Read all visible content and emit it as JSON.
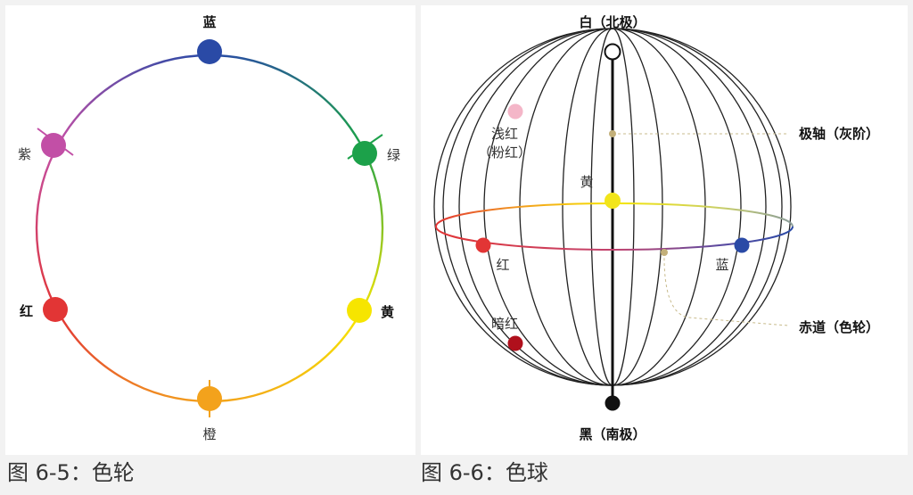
{
  "color_wheel": {
    "caption": "图 6-5：色轮",
    "labels": {
      "blue": "蓝",
      "green": "绿",
      "yellow": "黄",
      "orange": "橙",
      "red": "红",
      "purple": "紫"
    },
    "colors": {
      "blue": "#2a4aa6",
      "green": "#1ca14a",
      "yellow": "#f6e500",
      "orange": "#f3a21c",
      "red": "#e23535",
      "purple": "#c24fa6"
    }
  },
  "color_sphere": {
    "caption": "图 6-6：色球",
    "labels": {
      "north": "白（北极）",
      "south": "黑（南极）",
      "axis": "极轴（灰阶）",
      "equator": "赤道（色轮）",
      "light_red_1": "浅红",
      "light_red_2": "（粉红）",
      "yellow": "黄",
      "red": "红",
      "blue": "蓝",
      "dark_red": "暗红"
    },
    "colors": {
      "light_red": "#f4b6c8",
      "yellow": "#f2e51a",
      "red": "#e23535",
      "blue": "#2a4aa6",
      "dark_red": "#b0101c",
      "gray_dot": "#c3b07a"
    }
  }
}
